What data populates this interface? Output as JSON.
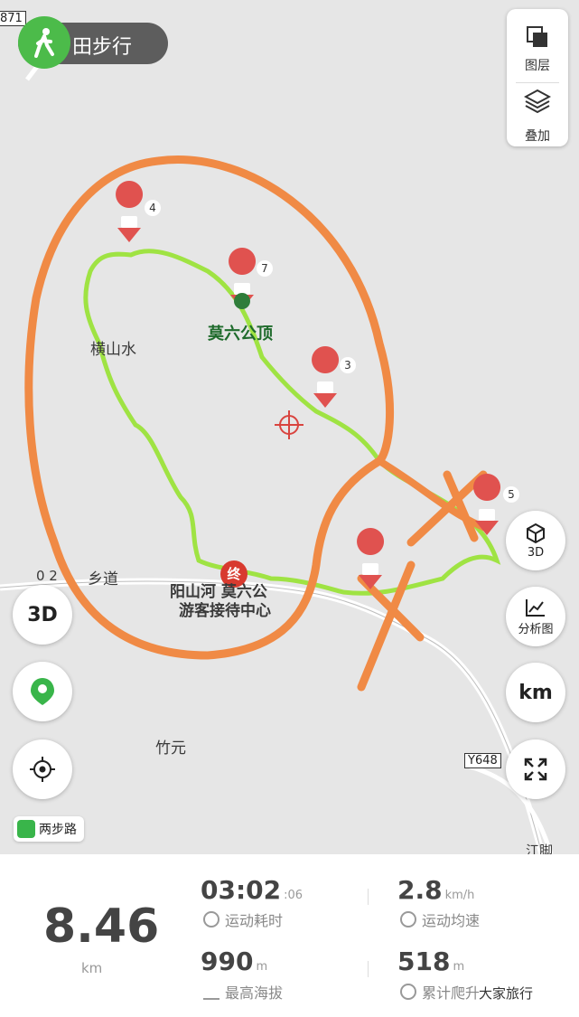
{
  "map": {
    "mode_label": "田步行",
    "road_code_top": "871",
    "layers": [
      {
        "label": "图层",
        "icon": "layers-icon"
      },
      {
        "label": "叠加",
        "icon": "overlay-icon"
      }
    ],
    "place_labels": {
      "peak": "莫六公顶",
      "hengshanshui": "横山水",
      "township_road": "乡道",
      "road_fragment": "0 2",
      "visitor_center_line1": "阳山河 莫六公",
      "visitor_center_line2": "游客接待中心",
      "zhuyuan": "竹元",
      "road_y648": "Y648",
      "jiangjiao": "江脚"
    },
    "end_marker": "终",
    "photo_counts": [
      "4",
      "7",
      "3",
      "5"
    ],
    "side_buttons": {
      "three_d": "3D",
      "analysis": "分析图",
      "unit": "km"
    },
    "chip_label": "两步路"
  },
  "stats": {
    "distance_value": "8.46",
    "distance_unit": "km",
    "duration_main": "03:02",
    "duration_sec": ":06",
    "duration_label": "运动耗时",
    "speed_value": "2.8",
    "speed_unit": "km/h",
    "speed_label": "运动均速",
    "altitude_value": "990",
    "altitude_unit": "m",
    "altitude_label": "最高海拔",
    "climb_value": "518",
    "climb_unit": "m",
    "climb_label": "累计爬升",
    "watermark": "大家旅行"
  },
  "colors": {
    "track": "#9be33a",
    "annotation": "#f08a45",
    "pin": "#e0524f",
    "accent": "#4cbb4a"
  }
}
